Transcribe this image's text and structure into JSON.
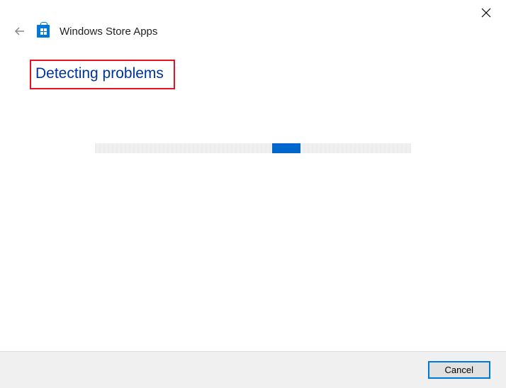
{
  "header": {
    "title": "Windows Store Apps"
  },
  "content": {
    "status_heading": "Detecting problems"
  },
  "footer": {
    "cancel_label": "Cancel"
  }
}
